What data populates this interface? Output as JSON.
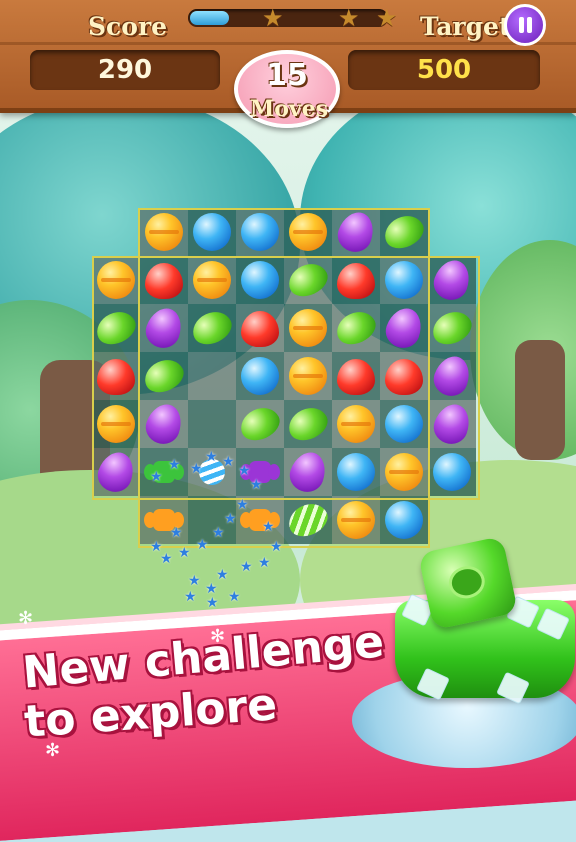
{
  "hud": {
    "score_label": "Score",
    "score_value": "290",
    "target_label": "Target",
    "target_value": "500",
    "moves_value": "15",
    "moves_label": "Moves",
    "progress": 0.2,
    "stars_earned": 0,
    "stars_total": 3,
    "pause_icon": "pause-icon"
  },
  "board": {
    "rows": [
      [
        "",
        "orange",
        "blue",
        "blue",
        "orange",
        "purple",
        "green",
        ""
      ],
      [
        "orange",
        "red",
        "orange",
        "blue",
        "green",
        "red",
        "blue",
        "purple"
      ],
      [
        "green",
        "purple",
        "green",
        "red",
        "orange",
        "green",
        "purple",
        "green"
      ],
      [
        "red",
        "green",
        "",
        "blue",
        "orange",
        "red",
        "red",
        "purple"
      ],
      [
        "orange",
        "purple",
        "",
        "green",
        "green",
        "orange",
        "blue",
        "purple"
      ],
      [
        "purple",
        "wrapped-green",
        "swirl-blue",
        "wrapped-purple",
        "purple",
        "blue",
        "orange",
        "blue"
      ],
      [
        "",
        "wrapped-orange",
        "",
        "wrapped-orange",
        "striped-green",
        "orange",
        "blue",
        ""
      ]
    ]
  },
  "banner": {
    "line1": "New challenge",
    "line2": "to explore"
  },
  "colors": {
    "wood": "#b8672f",
    "moves_pink": "#f59ab2",
    "banner_pink": "#e83c6d",
    "target_yellow": "#ffe14a"
  }
}
